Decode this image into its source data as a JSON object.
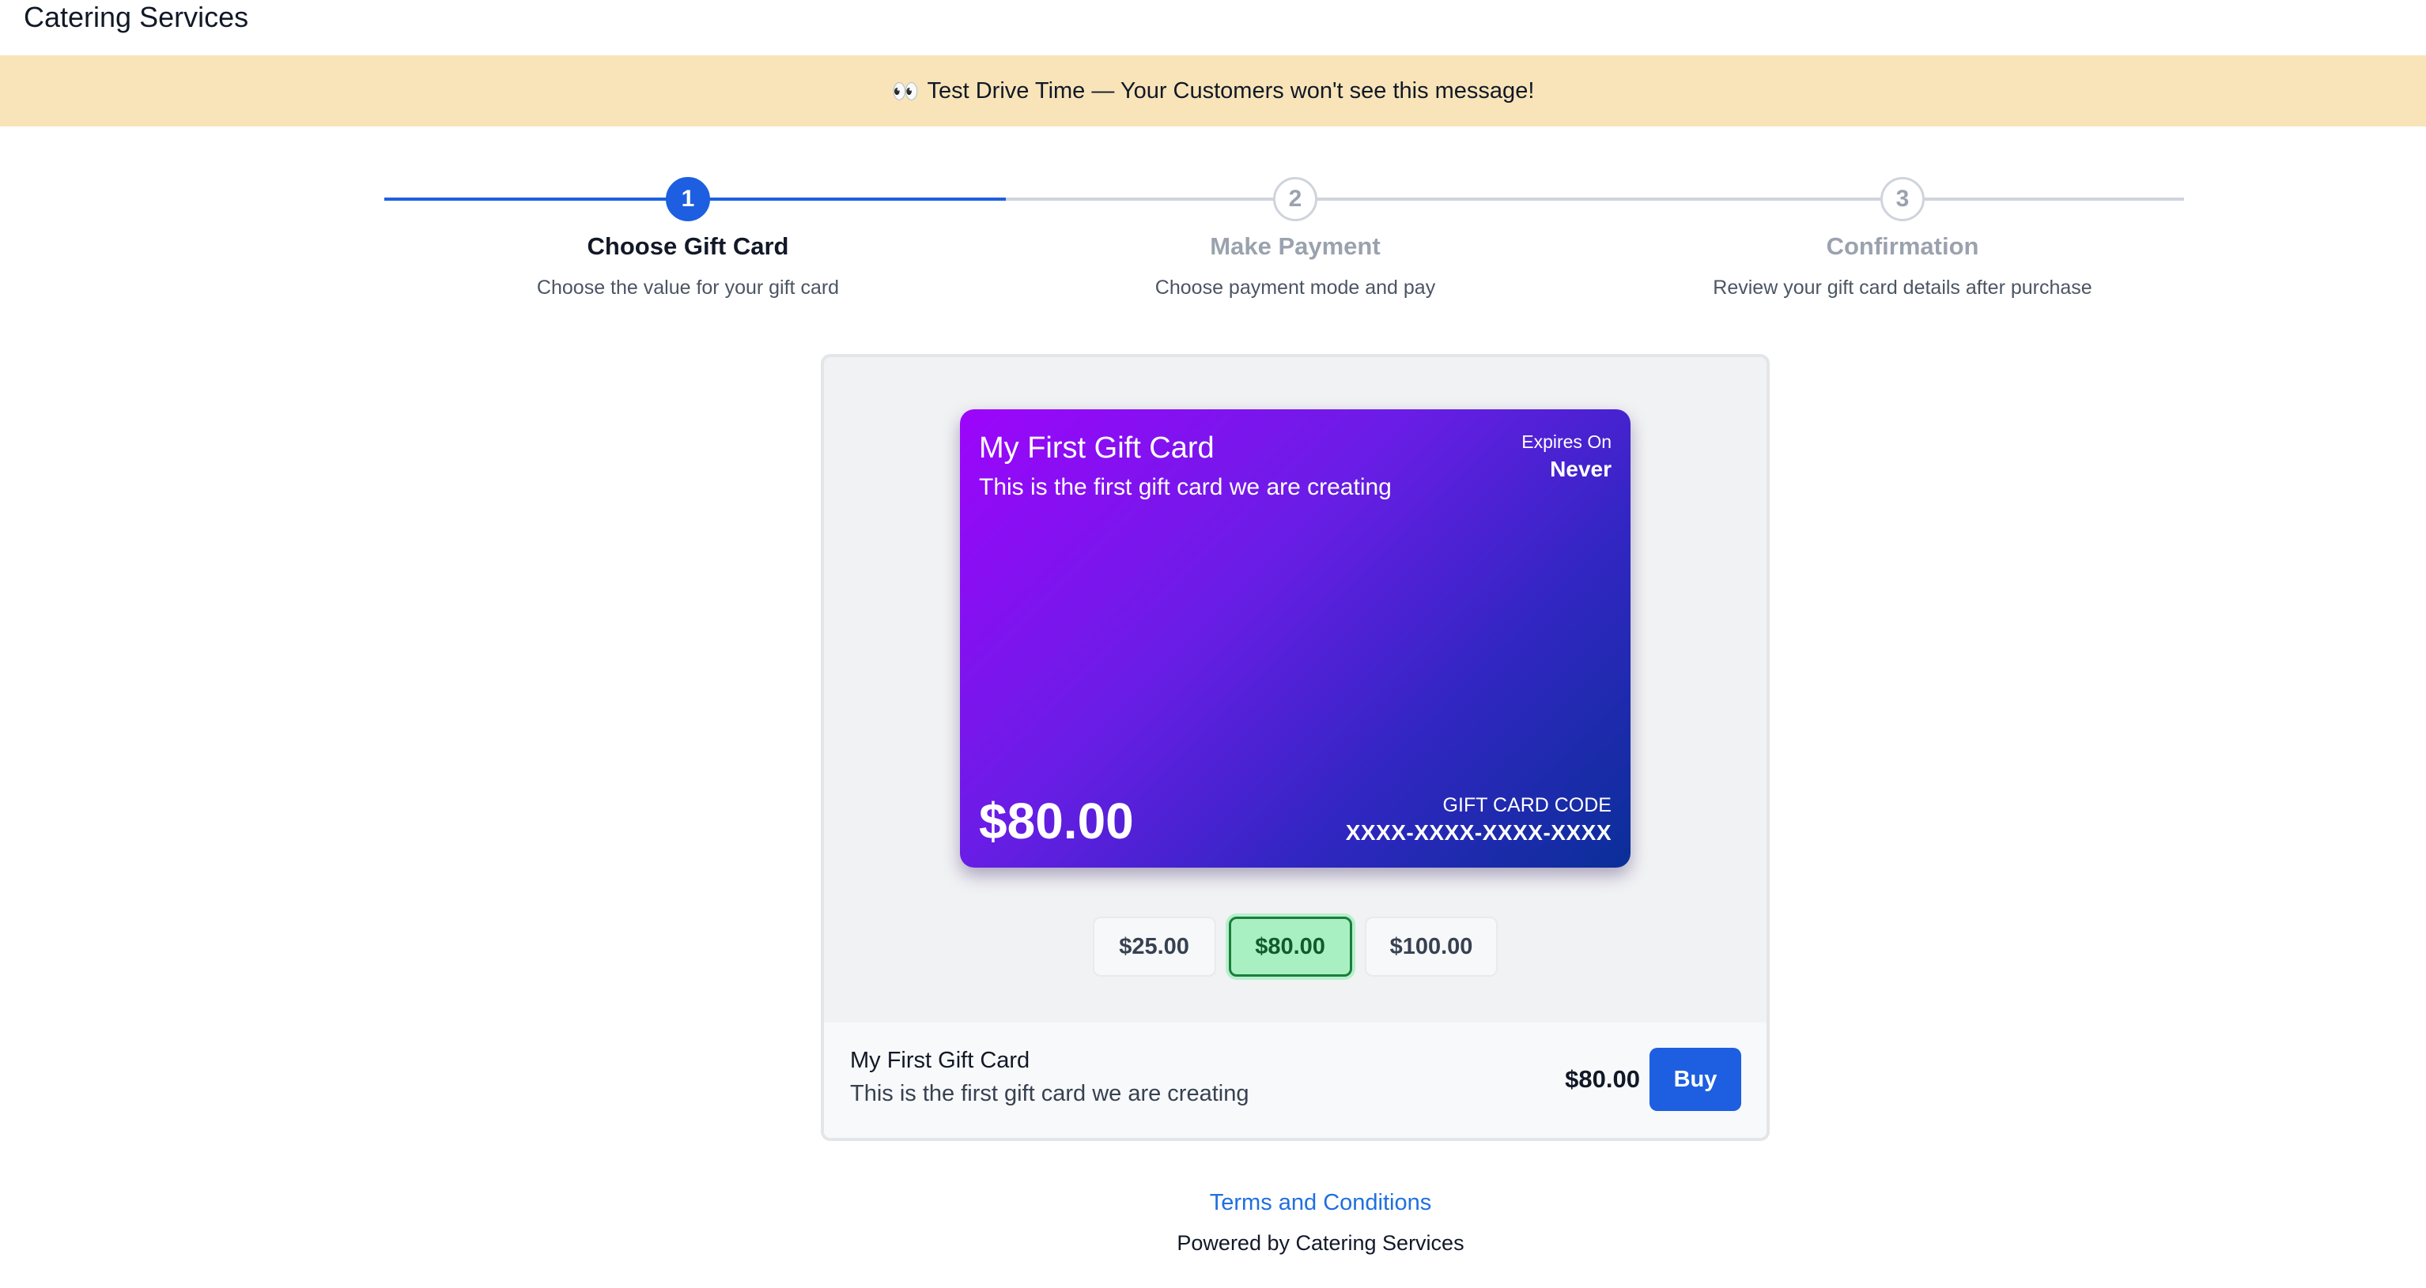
{
  "header": {
    "brand": "Catering Services"
  },
  "banner": {
    "icon": "eyes-emoji",
    "emoji": "👀",
    "text": "Test Drive Time — Your Customers won't see this message!"
  },
  "stepper": {
    "current_step": 1,
    "steps": [
      {
        "number": "1",
        "title": "Choose Gift Card",
        "description": "Choose the value for your gift card"
      },
      {
        "number": "2",
        "title": "Make Payment",
        "description": "Choose payment mode and pay"
      },
      {
        "number": "3",
        "title": "Confirmation",
        "description": "Review your gift card details after purchase"
      }
    ]
  },
  "gift_card": {
    "title": "My First Gift Card",
    "subtitle": "This is the first gift card we are creating",
    "expires_label": "Expires On",
    "expires_value": "Never",
    "amount": "$80.00",
    "code_label": "GIFT CARD CODE",
    "code": "XXXX-XXXX-XXXX-XXXX",
    "gradient_colors": [
      "#9d05fb",
      "#0a2f98"
    ]
  },
  "amount_options": {
    "selected": "$80.00",
    "options": [
      "$25.00",
      "$80.00",
      "$100.00"
    ]
  },
  "summary": {
    "title": "My First Gift Card",
    "description": "This is the first gift card we are creating",
    "price": "$80.00",
    "buy_label": "Buy"
  },
  "footer": {
    "terms_link": "Terms and Conditions",
    "powered_by": "Powered by Catering Services"
  },
  "colors": {
    "accent": "#1d5fe0",
    "banner_bg": "#f8e4b8",
    "selected_bg": "#a8f0c2",
    "selected_border": "#1b7d3c"
  }
}
